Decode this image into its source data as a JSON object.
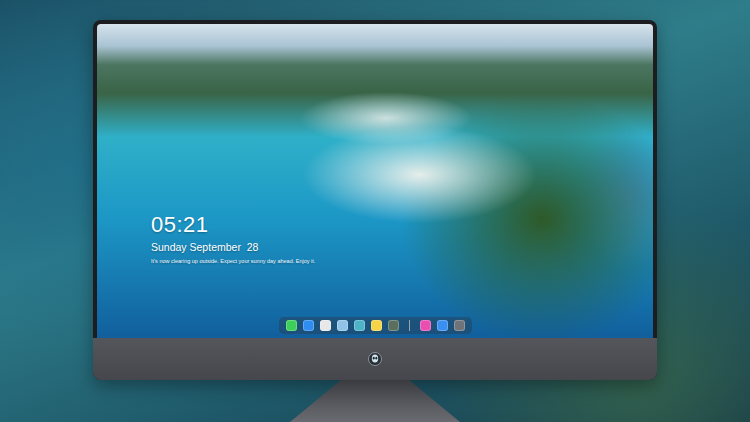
{
  "desktop": {
    "clock": "05:21",
    "date": "Sunday September  28",
    "message": "It's now clearing up outside. Expect your sunny day ahead. Enjoy it."
  },
  "dock": {
    "items": [
      {
        "kind": "app",
        "color": "#3ecf5a"
      },
      {
        "kind": "app",
        "color": "#2f8cf0"
      },
      {
        "kind": "app",
        "color": "#e8e8e8"
      },
      {
        "kind": "app",
        "color": "#8fc4e8"
      },
      {
        "kind": "app",
        "color": "#4fb3c8"
      },
      {
        "kind": "app",
        "color": "#f5d547"
      },
      {
        "kind": "app",
        "color": "#5a6f5e"
      },
      {
        "kind": "separator",
        "color": "#9aa4aa"
      },
      {
        "kind": "app",
        "color": "#e94fb0"
      },
      {
        "kind": "app",
        "color": "#3a8ff2"
      },
      {
        "kind": "app",
        "color": "#6d7378"
      }
    ]
  }
}
